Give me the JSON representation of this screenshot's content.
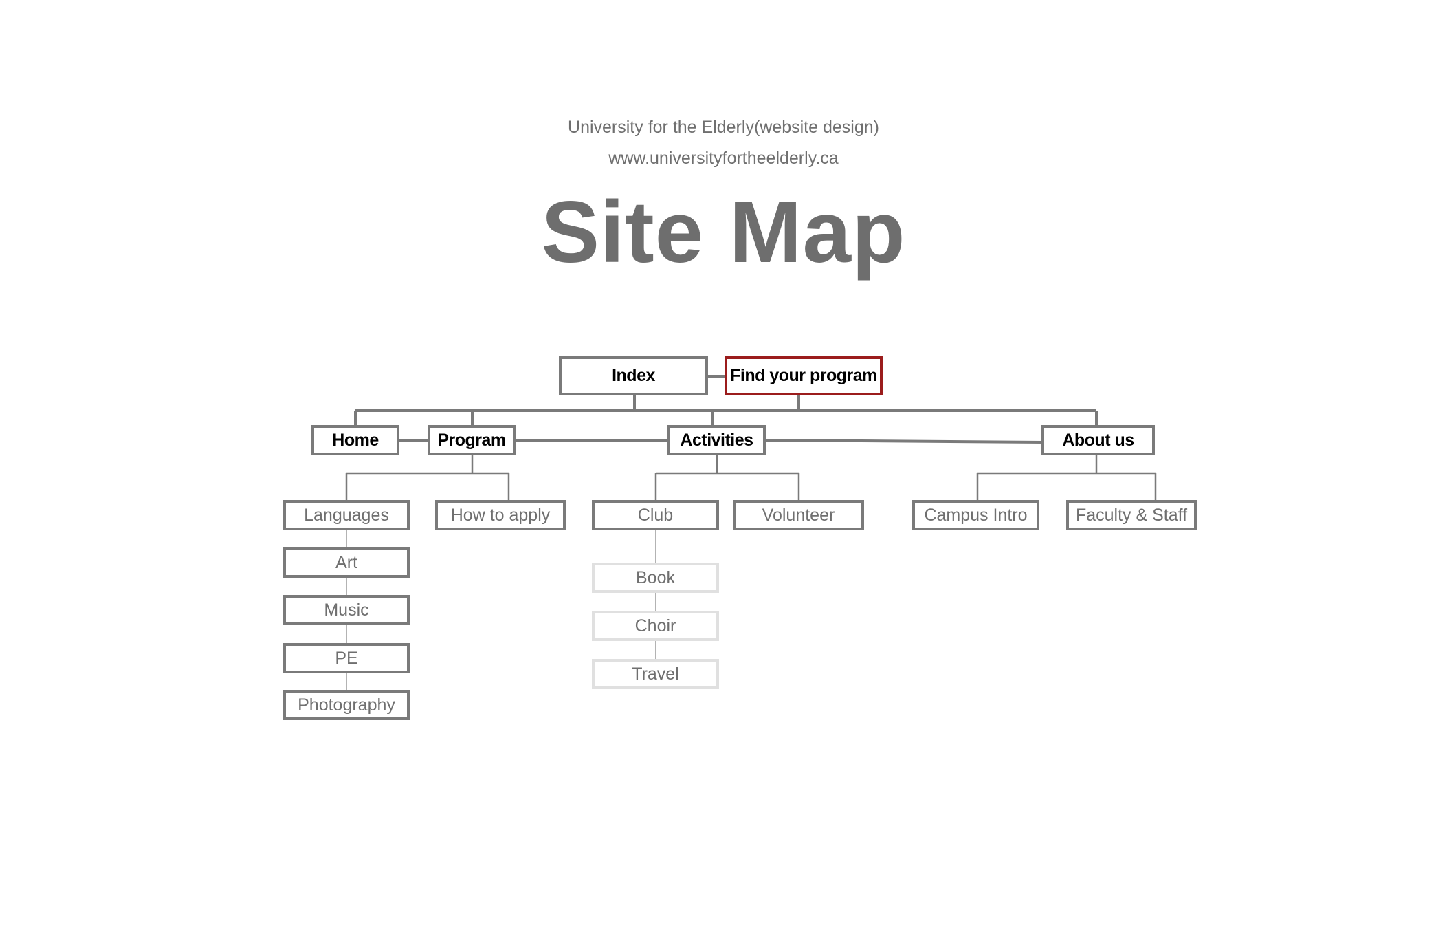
{
  "header": {
    "subtitle": "University for the Elderly(website design)",
    "url": "www.universityfortheelderly.ca",
    "title": "Site Map"
  },
  "sitemap": {
    "top": [
      "Index",
      "Find your program"
    ],
    "main_nav": [
      "Home",
      "Program",
      "Activities",
      "About us"
    ],
    "program": {
      "children": [
        "Languages",
        "How to apply"
      ],
      "languages": [
        "Art",
        "Music",
        "PE",
        "Photography"
      ]
    },
    "activities": {
      "children": [
        "Club",
        "Volunteer"
      ],
      "club": [
        "Book",
        "Choir",
        "Travel"
      ]
    },
    "about": {
      "children": [
        "Campus Intro",
        "Faculty & Staff"
      ]
    }
  },
  "colors": {
    "text_gray": "#6f6f6f",
    "box_border": "#7a7a7a",
    "faint_border": "#e0e0e0",
    "highlight_border": "#9b1c1c"
  }
}
